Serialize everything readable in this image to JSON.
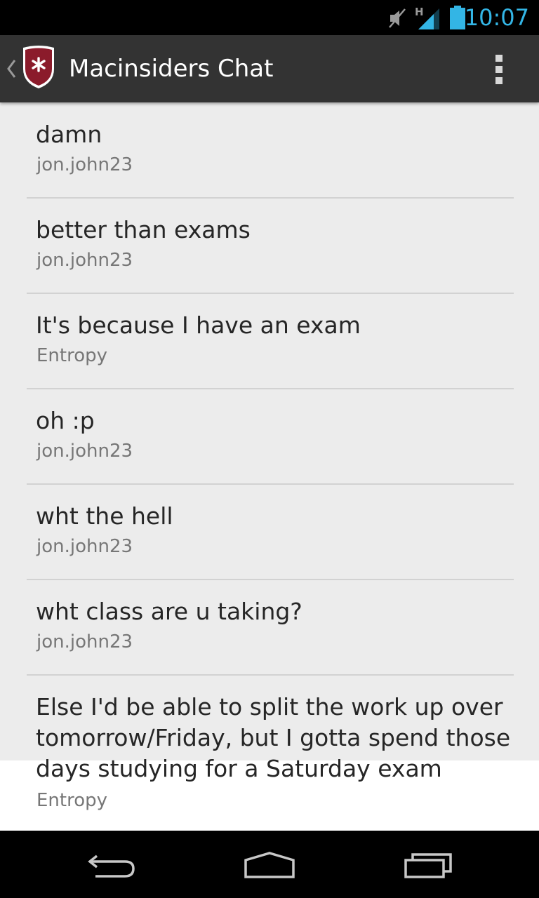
{
  "status_bar": {
    "time": "10:07",
    "network_type": "H",
    "icons": [
      "mute-icon",
      "signal-icon",
      "battery-icon"
    ],
    "time_color": "#33b5e5"
  },
  "action_bar": {
    "title": "Macinsiders Chat",
    "logo_icon": "shield-asterisk-icon",
    "brand_color": "#8b1b2b"
  },
  "messages": [
    {
      "text": "damn",
      "author": "jon.john23"
    },
    {
      "text": "better than exams",
      "author": "jon.john23"
    },
    {
      "text": "It's because I have an exam",
      "author": "Entropy"
    },
    {
      "text": "oh :p",
      "author": "jon.john23"
    },
    {
      "text": "wht the hell",
      "author": "jon.john23"
    },
    {
      "text": "wht class are u taking?",
      "author": "jon.john23"
    },
    {
      "text": "Else I'd be able to split the work up over tomorrow/Friday, but I gotta spend those days studying for a Saturday exam",
      "author": "Entropy"
    }
  ],
  "nav_bar": {
    "icons": [
      "back-icon",
      "home-icon",
      "recent-apps-icon"
    ]
  }
}
